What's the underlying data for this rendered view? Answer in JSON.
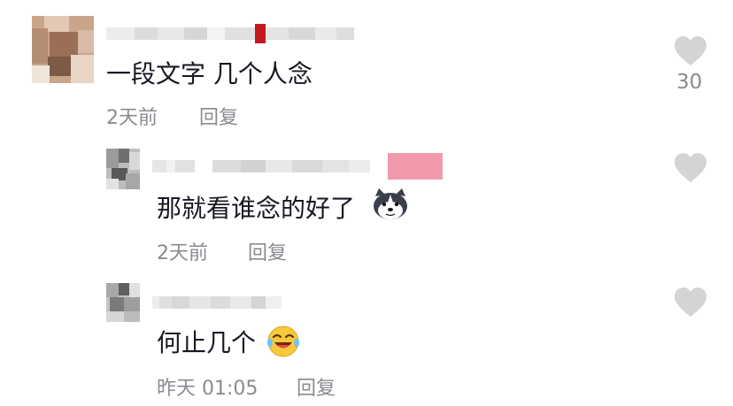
{
  "comments": [
    {
      "text": "一段文字 几个人念",
      "time": "2天前",
      "reply_label": "回复",
      "like_count": "30"
    },
    {
      "text": "那就看谁念的好了",
      "emoji": "husky-dog-emoji",
      "time": "2天前",
      "reply_label": "回复"
    },
    {
      "text": "何止几个",
      "emoji": "laughing-tears-emoji",
      "time": "昨天 01:05",
      "reply_label": "回复"
    }
  ],
  "colors": {
    "text": "#161823",
    "meta": "#8a8b91",
    "like_icon": "#d4d4d6"
  }
}
